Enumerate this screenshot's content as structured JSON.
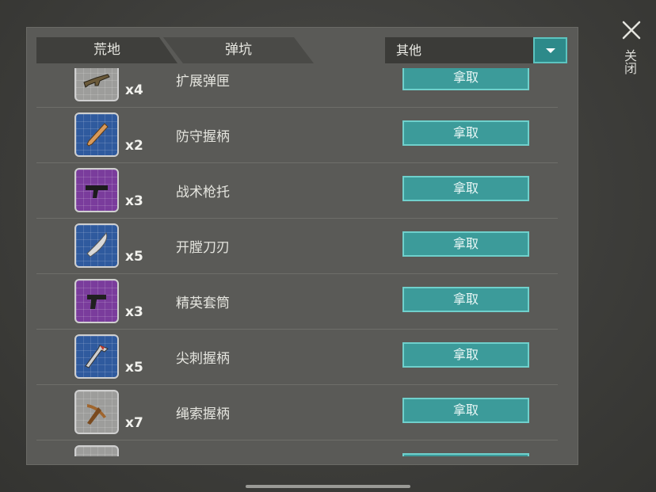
{
  "tabs": [
    {
      "label": "荒地"
    },
    {
      "label": "弹坑"
    }
  ],
  "filter": {
    "selected": "其他"
  },
  "close": {
    "label": "关闭"
  },
  "take_label": "拿取",
  "items": [
    {
      "name": "扩展弹匣",
      "qty": "x4",
      "rarity": "grey",
      "icon": "assault-rifle-icon"
    },
    {
      "name": "防守握柄",
      "qty": "x2",
      "rarity": "blue",
      "icon": "baseball-bat-icon"
    },
    {
      "name": "战术枪托",
      "qty": "x3",
      "rarity": "purple",
      "icon": "smg-icon"
    },
    {
      "name": "开膛刀刃",
      "qty": "x5",
      "rarity": "blue",
      "icon": "machete-icon"
    },
    {
      "name": "精英套筒",
      "qty": "x3",
      "rarity": "purple",
      "icon": "pistol-icon"
    },
    {
      "name": "尖刺握柄",
      "qty": "x5",
      "rarity": "blue",
      "icon": "hammer-icon"
    },
    {
      "name": "绳索握柄",
      "qty": "x7",
      "rarity": "grey",
      "icon": "pickaxe-icon"
    },
    {
      "name": "",
      "qty": "",
      "rarity": "grey",
      "icon": "item-icon"
    }
  ],
  "colors": {
    "accent": "#3c9b9a",
    "panel": "#5a5a57",
    "grey": "#9d9d9b",
    "blue": "#2f5a9e",
    "purple": "#7a3c9c"
  }
}
